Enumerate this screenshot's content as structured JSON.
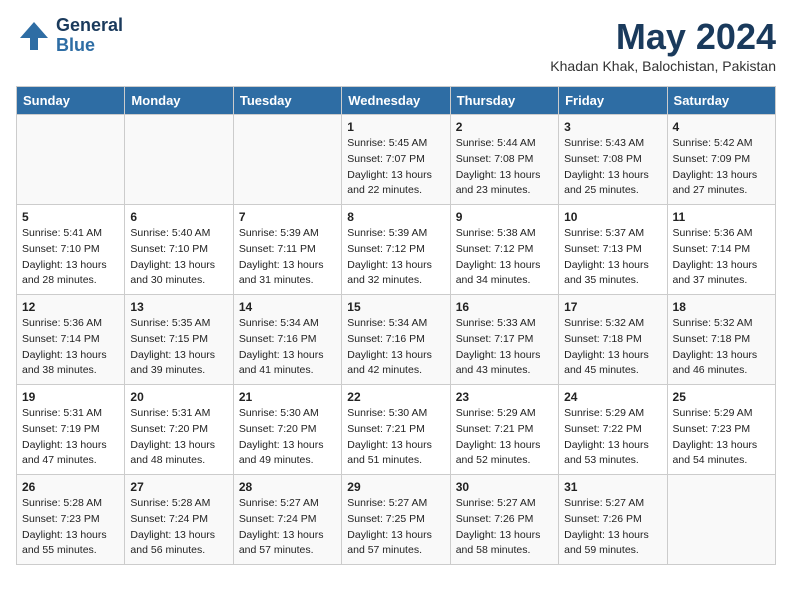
{
  "header": {
    "logo_line1": "General",
    "logo_line2": "Blue",
    "month": "May 2024",
    "location": "Khadan Khak, Balochistan, Pakistan"
  },
  "weekdays": [
    "Sunday",
    "Monday",
    "Tuesday",
    "Wednesday",
    "Thursday",
    "Friday",
    "Saturday"
  ],
  "weeks": [
    [
      {
        "day": "",
        "info": ""
      },
      {
        "day": "",
        "info": ""
      },
      {
        "day": "",
        "info": ""
      },
      {
        "day": "1",
        "info": "Sunrise: 5:45 AM\nSunset: 7:07 PM\nDaylight: 13 hours\nand 22 minutes."
      },
      {
        "day": "2",
        "info": "Sunrise: 5:44 AM\nSunset: 7:08 PM\nDaylight: 13 hours\nand 23 minutes."
      },
      {
        "day": "3",
        "info": "Sunrise: 5:43 AM\nSunset: 7:08 PM\nDaylight: 13 hours\nand 25 minutes."
      },
      {
        "day": "4",
        "info": "Sunrise: 5:42 AM\nSunset: 7:09 PM\nDaylight: 13 hours\nand 27 minutes."
      }
    ],
    [
      {
        "day": "5",
        "info": "Sunrise: 5:41 AM\nSunset: 7:10 PM\nDaylight: 13 hours\nand 28 minutes."
      },
      {
        "day": "6",
        "info": "Sunrise: 5:40 AM\nSunset: 7:10 PM\nDaylight: 13 hours\nand 30 minutes."
      },
      {
        "day": "7",
        "info": "Sunrise: 5:39 AM\nSunset: 7:11 PM\nDaylight: 13 hours\nand 31 minutes."
      },
      {
        "day": "8",
        "info": "Sunrise: 5:39 AM\nSunset: 7:12 PM\nDaylight: 13 hours\nand 32 minutes."
      },
      {
        "day": "9",
        "info": "Sunrise: 5:38 AM\nSunset: 7:12 PM\nDaylight: 13 hours\nand 34 minutes."
      },
      {
        "day": "10",
        "info": "Sunrise: 5:37 AM\nSunset: 7:13 PM\nDaylight: 13 hours\nand 35 minutes."
      },
      {
        "day": "11",
        "info": "Sunrise: 5:36 AM\nSunset: 7:14 PM\nDaylight: 13 hours\nand 37 minutes."
      }
    ],
    [
      {
        "day": "12",
        "info": "Sunrise: 5:36 AM\nSunset: 7:14 PM\nDaylight: 13 hours\nand 38 minutes."
      },
      {
        "day": "13",
        "info": "Sunrise: 5:35 AM\nSunset: 7:15 PM\nDaylight: 13 hours\nand 39 minutes."
      },
      {
        "day": "14",
        "info": "Sunrise: 5:34 AM\nSunset: 7:16 PM\nDaylight: 13 hours\nand 41 minutes."
      },
      {
        "day": "15",
        "info": "Sunrise: 5:34 AM\nSunset: 7:16 PM\nDaylight: 13 hours\nand 42 minutes."
      },
      {
        "day": "16",
        "info": "Sunrise: 5:33 AM\nSunset: 7:17 PM\nDaylight: 13 hours\nand 43 minutes."
      },
      {
        "day": "17",
        "info": "Sunrise: 5:32 AM\nSunset: 7:18 PM\nDaylight: 13 hours\nand 45 minutes."
      },
      {
        "day": "18",
        "info": "Sunrise: 5:32 AM\nSunset: 7:18 PM\nDaylight: 13 hours\nand 46 minutes."
      }
    ],
    [
      {
        "day": "19",
        "info": "Sunrise: 5:31 AM\nSunset: 7:19 PM\nDaylight: 13 hours\nand 47 minutes."
      },
      {
        "day": "20",
        "info": "Sunrise: 5:31 AM\nSunset: 7:20 PM\nDaylight: 13 hours\nand 48 minutes."
      },
      {
        "day": "21",
        "info": "Sunrise: 5:30 AM\nSunset: 7:20 PM\nDaylight: 13 hours\nand 49 minutes."
      },
      {
        "day": "22",
        "info": "Sunrise: 5:30 AM\nSunset: 7:21 PM\nDaylight: 13 hours\nand 51 minutes."
      },
      {
        "day": "23",
        "info": "Sunrise: 5:29 AM\nSunset: 7:21 PM\nDaylight: 13 hours\nand 52 minutes."
      },
      {
        "day": "24",
        "info": "Sunrise: 5:29 AM\nSunset: 7:22 PM\nDaylight: 13 hours\nand 53 minutes."
      },
      {
        "day": "25",
        "info": "Sunrise: 5:29 AM\nSunset: 7:23 PM\nDaylight: 13 hours\nand 54 minutes."
      }
    ],
    [
      {
        "day": "26",
        "info": "Sunrise: 5:28 AM\nSunset: 7:23 PM\nDaylight: 13 hours\nand 55 minutes."
      },
      {
        "day": "27",
        "info": "Sunrise: 5:28 AM\nSunset: 7:24 PM\nDaylight: 13 hours\nand 56 minutes."
      },
      {
        "day": "28",
        "info": "Sunrise: 5:27 AM\nSunset: 7:24 PM\nDaylight: 13 hours\nand 57 minutes."
      },
      {
        "day": "29",
        "info": "Sunrise: 5:27 AM\nSunset: 7:25 PM\nDaylight: 13 hours\nand 57 minutes."
      },
      {
        "day": "30",
        "info": "Sunrise: 5:27 AM\nSunset: 7:26 PM\nDaylight: 13 hours\nand 58 minutes."
      },
      {
        "day": "31",
        "info": "Sunrise: 5:27 AM\nSunset: 7:26 PM\nDaylight: 13 hours\nand 59 minutes."
      },
      {
        "day": "",
        "info": ""
      }
    ]
  ]
}
